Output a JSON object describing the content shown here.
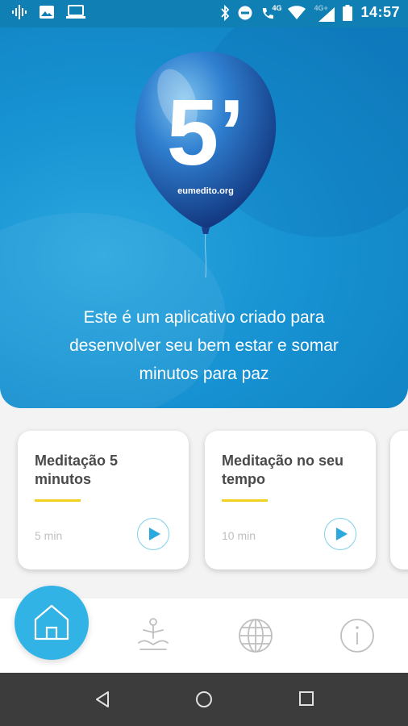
{
  "status_bar": {
    "time": "14:57",
    "network_primary": "4G",
    "network_secondary": "4G+",
    "icons": [
      "podcast-icon",
      "image-icon",
      "laptop-icon",
      "bluetooth-icon",
      "do-not-disturb-icon",
      "wifi-calling-icon",
      "wifi-icon",
      "signal-icon",
      "battery-icon"
    ]
  },
  "hero": {
    "balloon_number": "5’",
    "balloon_site": "eumedito.org",
    "tagline_lines": [
      "Este é um aplicativo criado para",
      "desenvolver seu bem estar e somar",
      "minutos para paz"
    ]
  },
  "cards": [
    {
      "title_lines": [
        "Meditação 5",
        "minutos"
      ],
      "duration": "5 min"
    },
    {
      "title_lines": [
        "Meditação no seu",
        "tempo"
      ],
      "duration": "10 min"
    }
  ],
  "bottom_nav": {
    "items": [
      "home-icon",
      "meditation-icon",
      "globe-icon",
      "info-icon"
    ],
    "active": "home-icon"
  },
  "colors": {
    "hero_blue": "#1792d2",
    "accent_cyan": "#32b3e6",
    "bar_yellow": "#f0d020",
    "nav_gray": "#3c3c3c"
  }
}
